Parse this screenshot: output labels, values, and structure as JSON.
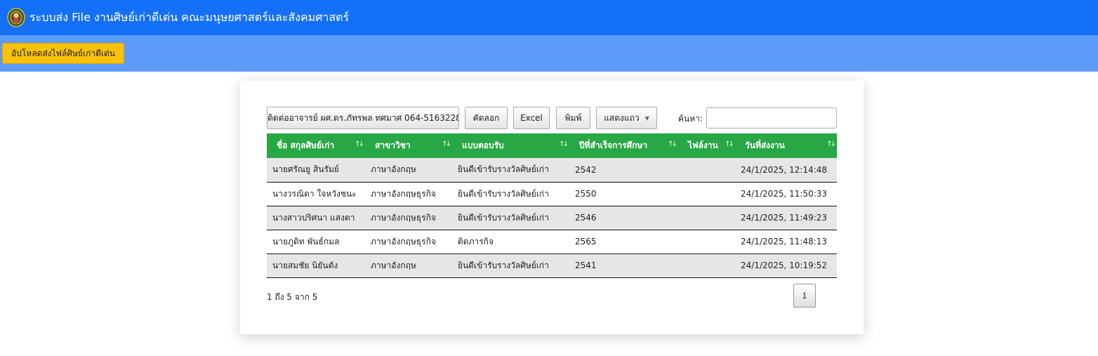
{
  "header": {
    "title": "ระบบส่ง File งานศิษย์เก่าดีเด่น คณะมนุษยศาสตร์และสังคมศาสตร์"
  },
  "toolbar": {
    "upload_label": "อัปโหลดส่งไฟล์ศิษย์เก่าดีเด่น"
  },
  "table_controls": {
    "contact_label": "ติดต่ออาจารย์ ผศ.ดร.ภัทรพล ทศมาศ 064-5163228",
    "copy_label": "คัดลอก",
    "excel_label": "Excel",
    "print_label": "พิมพ์",
    "rows_label": "แสดงแถว",
    "search_label": "ค้นหา:",
    "search_value": ""
  },
  "table": {
    "columns": [
      "ชื่อ สกุลศิษย์เก่า",
      "สาขาวิชา",
      "แบบตอบรับ",
      "ปีที่สำเร็จการศึกษา",
      "ไฟล์งาน",
      "วันที่ส่งงาน"
    ],
    "rows": [
      [
        "นายศรัณยู สินรัมย์",
        "ภาษาอังกฤษ",
        "ยินดีเข้ารับรางวัลศิษย์เก่า",
        "2542",
        "",
        "24/1/2025, 12:14:48"
      ],
      [
        "นางวรณิดา ใจหวังชนะ",
        "ภาษาอังกฤษธุรกิจ",
        "ยินดีเข้ารับรางวัลศิษย์เก่า",
        "2550",
        "",
        "24/1/2025, 11:50:33"
      ],
      [
        "นางสาวปริศนา แสงตา",
        "ภาษาอังกฤษธุรกิจ",
        "ยินดีเข้ารับรางวัลศิษย์เก่า",
        "2546",
        "",
        "24/1/2025, 11:49:23"
      ],
      [
        "นายภูดิท พันธ์กมล",
        "ภาษาอังกฤษธุรกิจ",
        "ติดภารกิจ",
        "2565",
        "",
        "24/1/2025, 11:48:13"
      ],
      [
        "นายสมชัย นิยันตัง",
        "ภาษาอังกฤษ",
        "ยินดีเข้ารับรางวัลศิษย์เก่า",
        "2541",
        "",
        "24/1/2025, 10:19:52"
      ]
    ]
  },
  "footer": {
    "info": "1 ถึง 5 จาก 5",
    "page": "1"
  },
  "colors": {
    "header_bg": "#1570f8",
    "subbar_bg": "#5b9cfa",
    "upload_btn": "#fcc10b",
    "table_head": "#28a745"
  }
}
